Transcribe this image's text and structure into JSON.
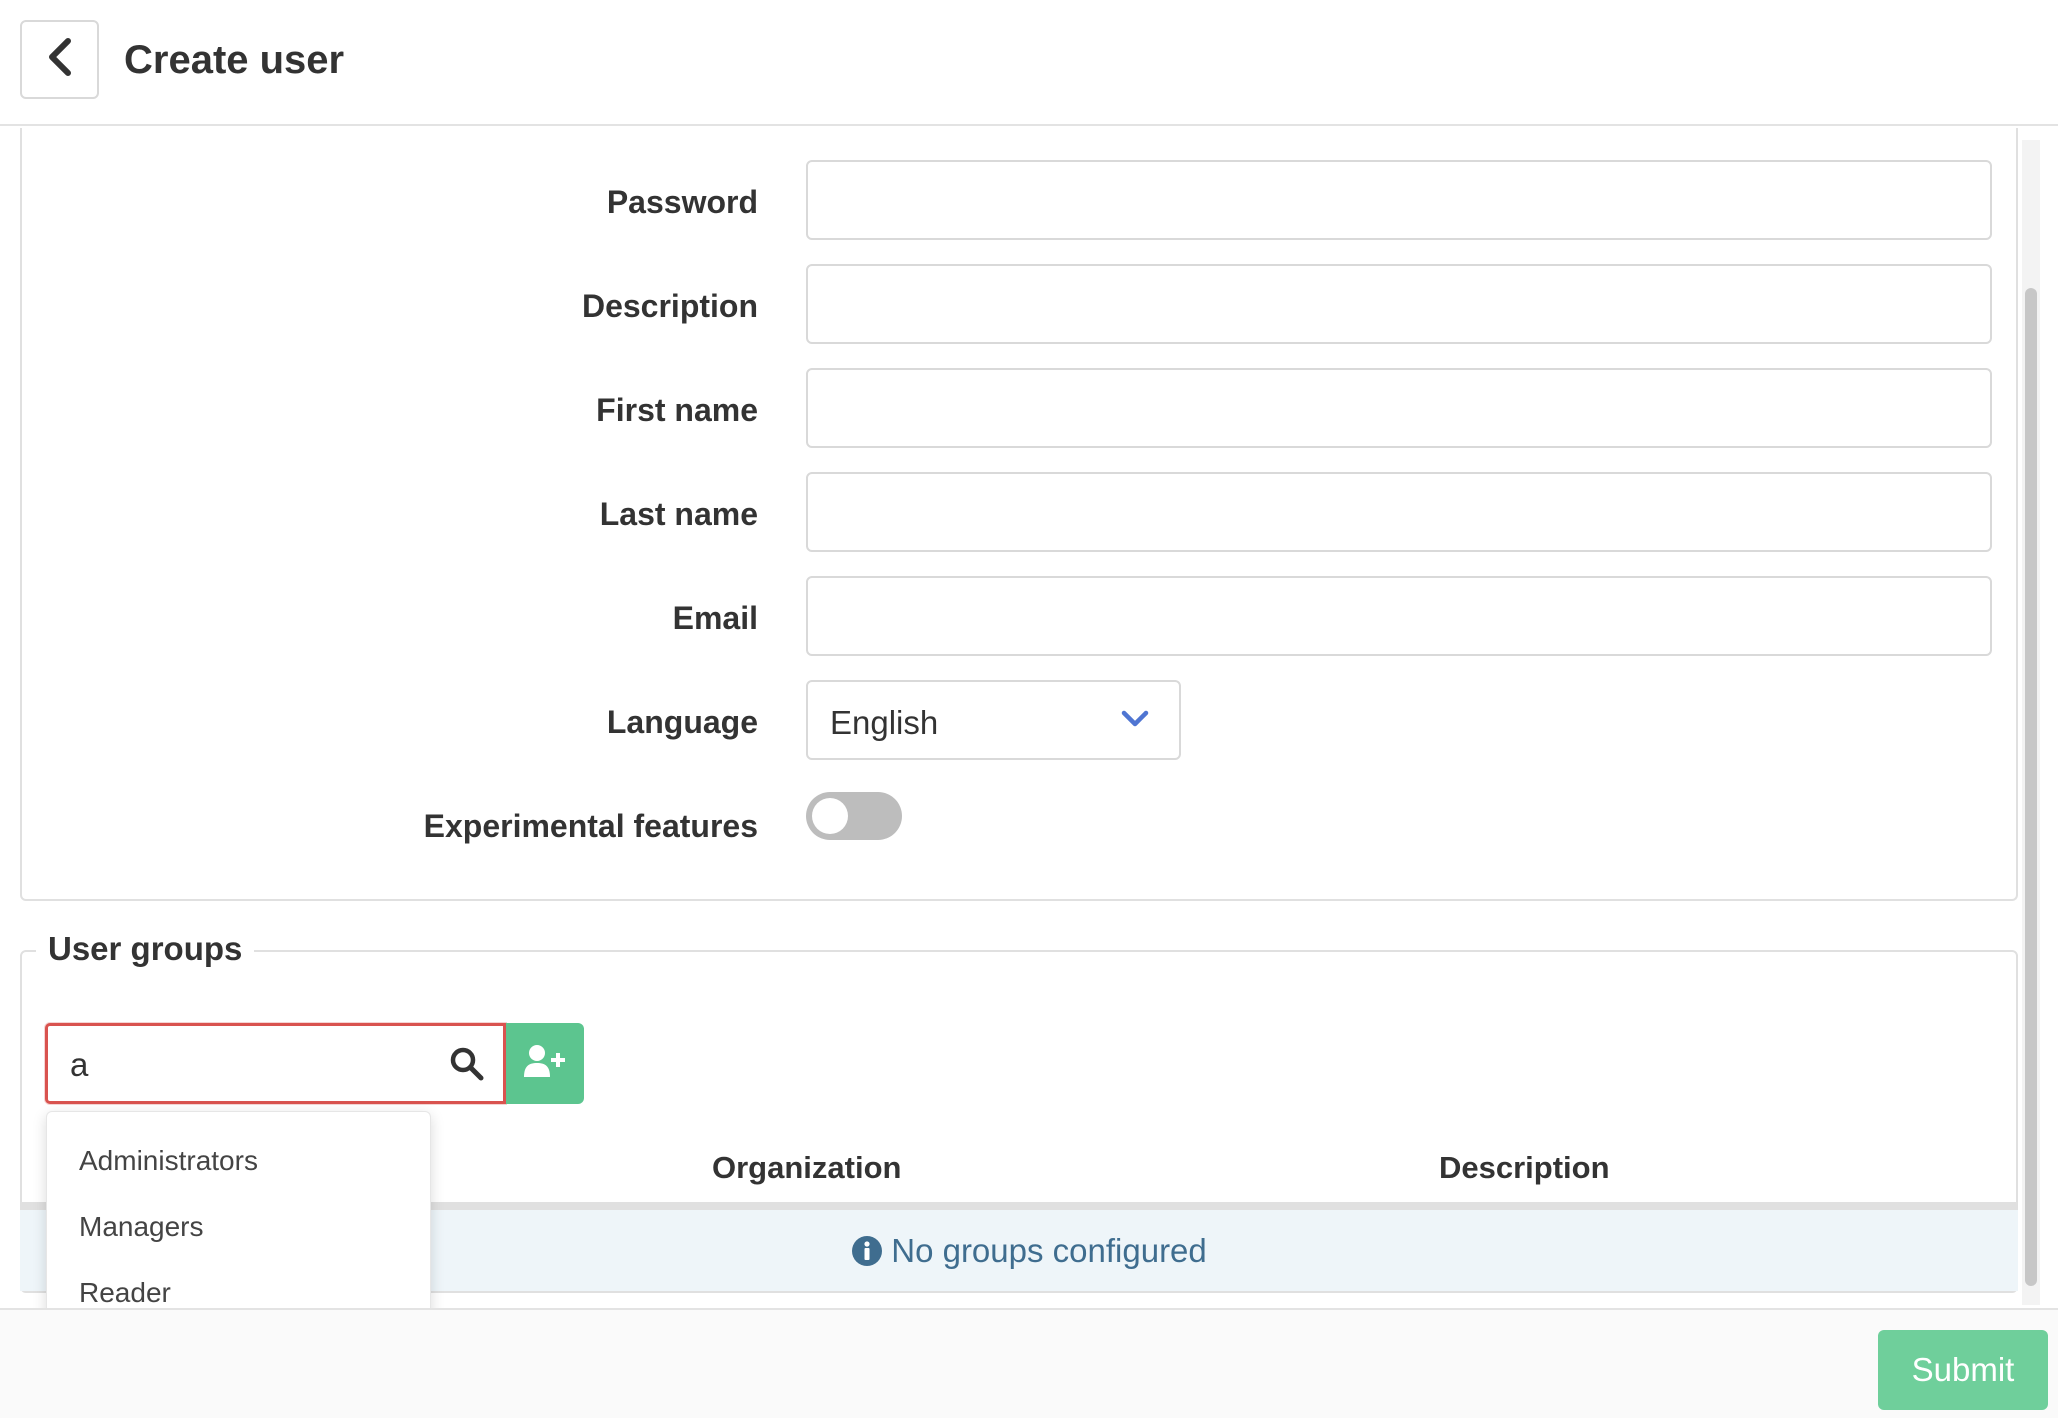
{
  "header": {
    "title": "Create user",
    "back_icon": "chevron-left-icon"
  },
  "form": {
    "fields": [
      {
        "label": "Password",
        "value": ""
      },
      {
        "label": "Description",
        "value": ""
      },
      {
        "label": "First name",
        "value": ""
      },
      {
        "label": "Last name",
        "value": ""
      },
      {
        "label": "Email",
        "value": ""
      }
    ],
    "language": {
      "label": "Language",
      "value": "English"
    },
    "experimental": {
      "label": "Experimental features",
      "enabled": false
    }
  },
  "groups": {
    "legend": "User groups",
    "search_value": "a",
    "search_icon": "search-icon",
    "add_icon": "user-plus-icon",
    "columns": [
      "Organization",
      "Description"
    ],
    "empty_message": "No groups configured",
    "suggestions": [
      "Administrators",
      "Managers",
      "Reader"
    ]
  },
  "footer": {
    "submit_label": "Submit"
  },
  "colors": {
    "accent_green": "#5cc58f",
    "submit_green": "#6fcf9b",
    "error_red": "#d9534f",
    "info_blue": "#3f6d8f",
    "chevron_blue": "#4f75d2"
  }
}
